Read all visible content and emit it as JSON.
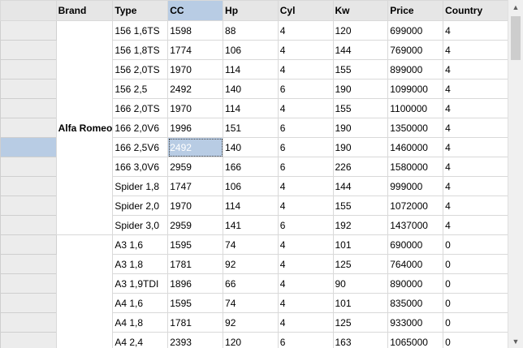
{
  "columns": [
    "",
    "Brand",
    "Type",
    "CC",
    "Hp",
    "Cyl",
    "Kw",
    "Price",
    "Country"
  ],
  "groups": [
    {
      "brand": "Alfa Romeo",
      "rows": [
        [
          "156 1,6TS",
          "1598",
          "88",
          "4",
          "120",
          "699000",
          "4"
        ],
        [
          "156 1,8TS",
          "1774",
          "106",
          "4",
          "144",
          "769000",
          "4"
        ],
        [
          "156 2,0TS",
          "1970",
          "114",
          "4",
          "155",
          "899000",
          "4"
        ],
        [
          "156 2,5",
          "2492",
          "140",
          "6",
          "190",
          "1099000",
          "4"
        ],
        [
          "166 2,0TS",
          "1970",
          "114",
          "4",
          "155",
          "1100000",
          "4"
        ],
        [
          "166 2,0V6",
          "1996",
          "151",
          "6",
          "190",
          "1350000",
          "4"
        ],
        [
          "166 2,5V6",
          "2492",
          "140",
          "6",
          "190",
          "1460000",
          "4"
        ],
        [
          "166 3,0V6",
          "2959",
          "166",
          "6",
          "226",
          "1580000",
          "4"
        ],
        [
          "Spider 1,8",
          "1747",
          "106",
          "4",
          "144",
          "999000",
          "4"
        ],
        [
          "Spider 2,0",
          "1970",
          "114",
          "4",
          "155",
          "1072000",
          "4"
        ],
        [
          "Spider 3,0",
          "2959",
          "141",
          "6",
          "192",
          "1437000",
          "4"
        ]
      ]
    },
    {
      "brand": "",
      "rows": [
        [
          "A3 1,6",
          "1595",
          "74",
          "4",
          "101",
          "690000",
          "0"
        ],
        [
          "A3 1,8",
          "1781",
          "92",
          "4",
          "125",
          "764000",
          "0"
        ],
        [
          "A3 1,9TDI",
          "1896",
          "66",
          "4",
          "90",
          "890000",
          "0"
        ],
        [
          "A4 1,6",
          "1595",
          "74",
          "4",
          "101",
          "835000",
          "0"
        ],
        [
          "A4 1,8",
          "1781",
          "92",
          "4",
          "125",
          "933000",
          "0"
        ],
        [
          "A4 2,4",
          "2393",
          "120",
          "6",
          "163",
          "1065000",
          "0"
        ]
      ]
    }
  ],
  "selection": {
    "row": 6,
    "column": 3
  },
  "colors": {
    "selection": "#b8cce4",
    "header": "#e6e6e6",
    "grid_line": "#d9d9d9"
  },
  "icons": {
    "scroll_up": "chevron-up-icon",
    "scroll_down": "chevron-down-icon"
  }
}
